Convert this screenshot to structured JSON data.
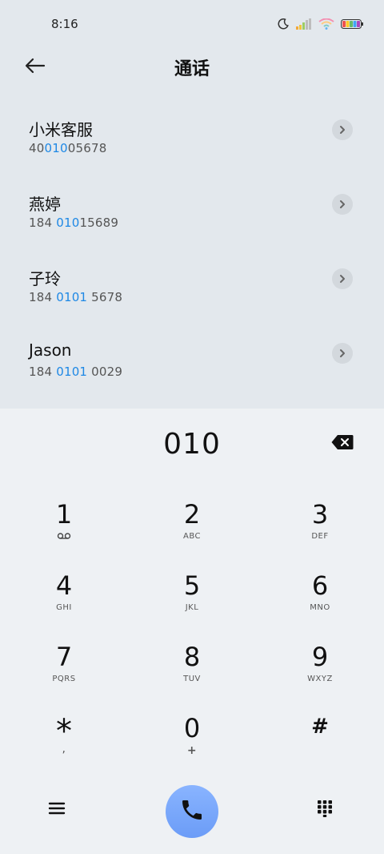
{
  "status": {
    "time": "8:16",
    "icons": [
      "moon-icon",
      "signal-icon",
      "wifi-icon",
      "battery-icon"
    ]
  },
  "header": {
    "title": "通话",
    "back_icon": "back-arrow-icon"
  },
  "results": [
    {
      "name": "小米客服",
      "number_pre": "40",
      "number_hl": "010",
      "number_post": "05678"
    },
    {
      "name": "燕婷",
      "number_pre": "184 ",
      "number_hl": "010",
      "number_post": "15689"
    },
    {
      "name": "子玲",
      "number_pre": "184 ",
      "number_hl": "0101",
      "number_post": " 5678"
    },
    {
      "name": "Jason",
      "number_pre": "184 ",
      "number_hl": "0101",
      "number_post": " 0029"
    }
  ],
  "dialpad": {
    "dialed": "010",
    "keys": [
      {
        "digit": "1",
        "letters": ""
      },
      {
        "digit": "2",
        "letters": "ABC"
      },
      {
        "digit": "3",
        "letters": "DEF"
      },
      {
        "digit": "4",
        "letters": "GHI"
      },
      {
        "digit": "5",
        "letters": "JKL"
      },
      {
        "digit": "6",
        "letters": "MNO"
      },
      {
        "digit": "7",
        "letters": "PQRS"
      },
      {
        "digit": "8",
        "letters": "TUV"
      },
      {
        "digit": "9",
        "letters": "WXYZ"
      },
      {
        "digit": "*",
        "letters": ","
      },
      {
        "digit": "0",
        "letters": "+"
      },
      {
        "digit": "#",
        "letters": ""
      }
    ]
  },
  "colors": {
    "highlight": "#1e88e5",
    "call_button": "#7aa8fb",
    "list_bg": "#e3e8ed",
    "dialpad_bg": "#eef1f4"
  }
}
